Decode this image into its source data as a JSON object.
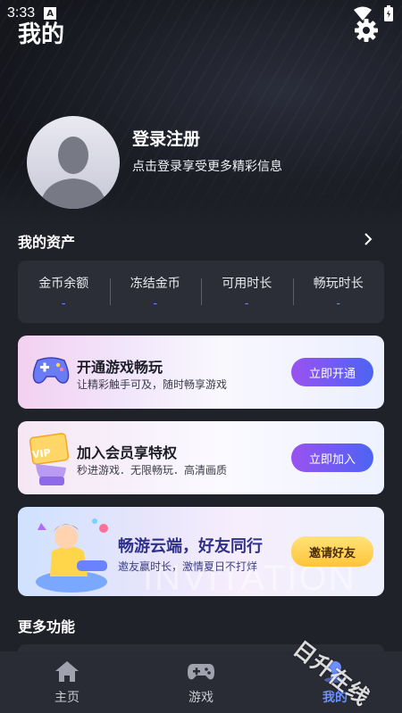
{
  "status": {
    "time": "3:33",
    "notification_letter": "A"
  },
  "header": {
    "title": "我的"
  },
  "profile": {
    "login_title": "登录注册",
    "login_subtitle": "点击登录享受更多精彩信息"
  },
  "assets": {
    "title": "我的资产",
    "items": [
      {
        "label": "金币余额",
        "value": "-"
      },
      {
        "label": "冻结金币",
        "value": "-"
      },
      {
        "label": "可用时长",
        "value": "-"
      },
      {
        "label": "畅玩时长",
        "value": "-"
      }
    ]
  },
  "promos": [
    {
      "title": "开通游戏畅玩",
      "subtitle": "让精彩触手可及，随时畅享游戏",
      "button": "立即开通"
    },
    {
      "title": "加入会员享特权",
      "subtitle": "秒进游戏．无限畅玩．高清画质",
      "button": "立即加入",
      "badge": "VIP"
    },
    {
      "title": "畅游云端，好友同行",
      "subtitle": "邀友赢时长，激情夏日不打烊",
      "button": "邀请好友",
      "watermark": "INVITATION"
    }
  ],
  "more": {
    "title": "更多功能"
  },
  "nav": {
    "items": [
      {
        "label": "主页",
        "icon": "home-icon"
      },
      {
        "label": "游戏",
        "icon": "gamepad-icon"
      },
      {
        "label": "我的",
        "icon": "profile-icon"
      }
    ],
    "active": "我的"
  },
  "watermark": "日升在线",
  "colors": {
    "accent": "#6f90ff",
    "background": "#1f2229",
    "card": "#2b2e37"
  }
}
